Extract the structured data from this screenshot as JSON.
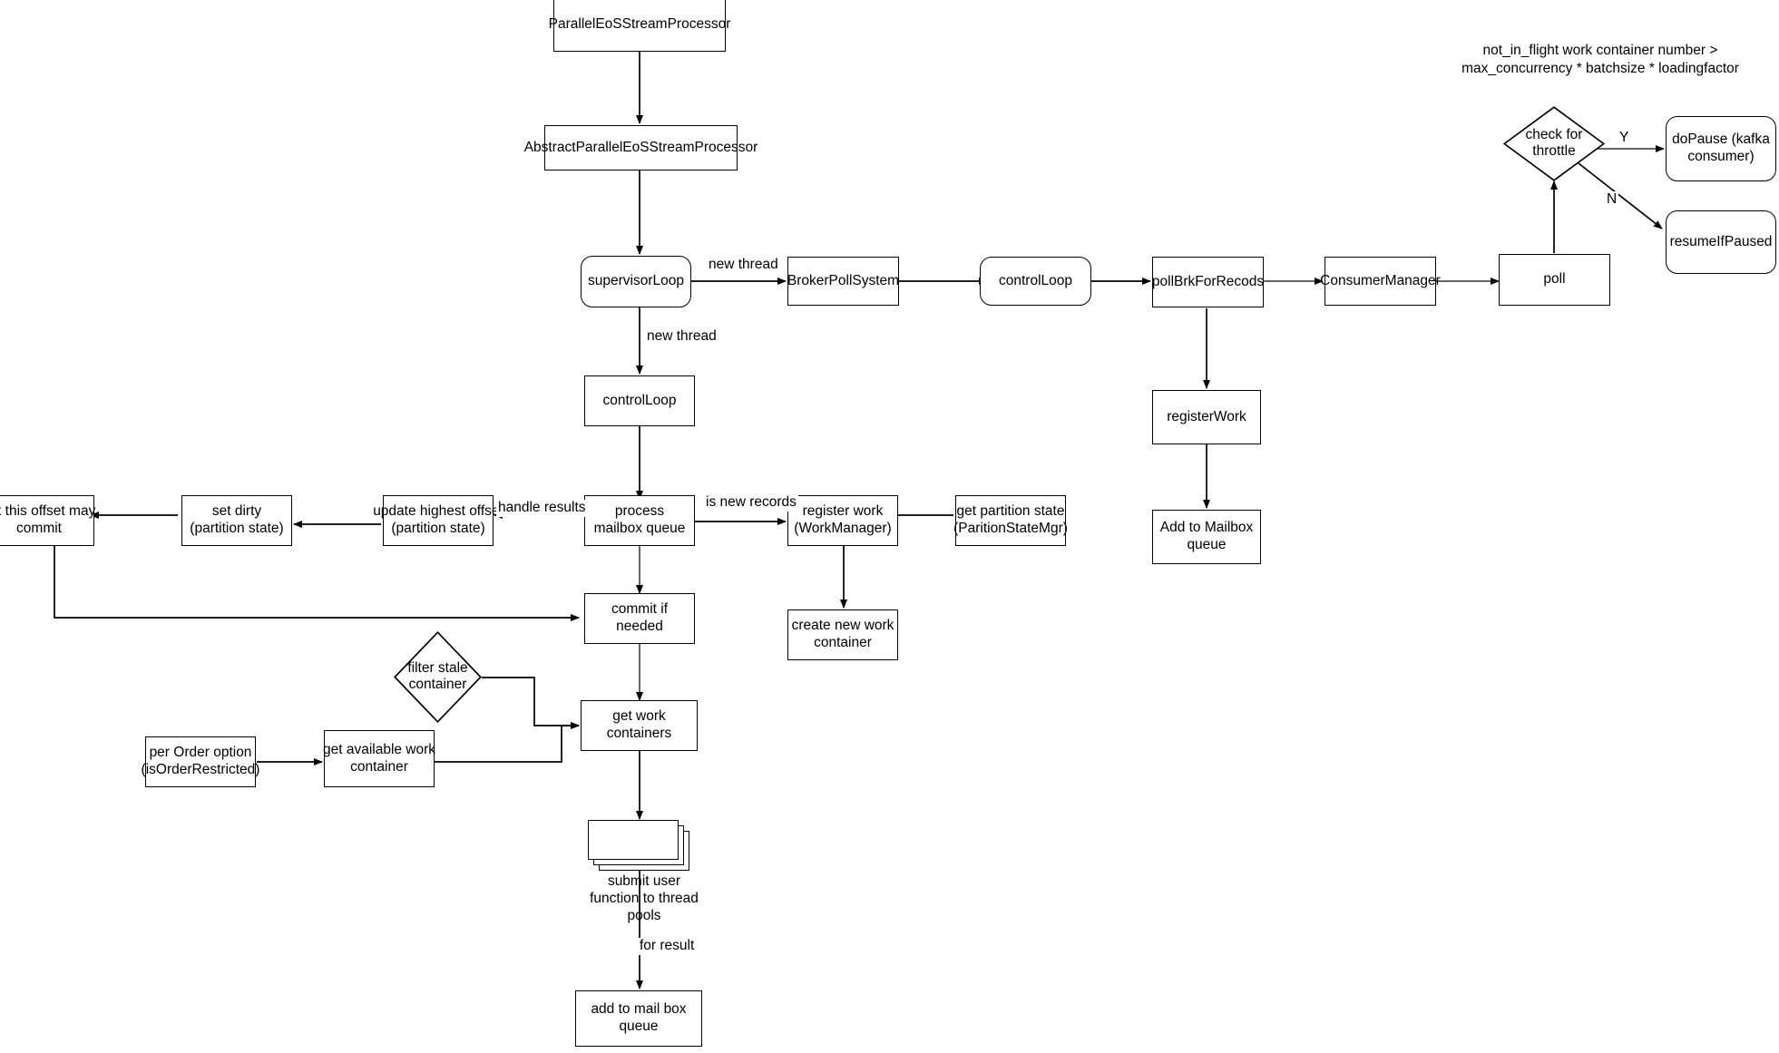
{
  "diagram": {
    "title_note": "not_in_flight work container number >\nmax_concurrency * batchsize * loadingfactor",
    "nodes": {
      "parallel_eos_stream_processor": "ParallelEoSStreamProcessor",
      "abstract_parallel_eos_stream_processor": "AbstractParallelEoSStreamProcessor",
      "supervisor_loop": "supervisorLoop",
      "broker_poll_system": "BrokerPollSystem",
      "control_loop_top": "controlLoop",
      "poll_brk_for_recods": "pollBrkForRecods",
      "consumer_manager": "ConsumerManager",
      "poll": "poll",
      "check_for_throttle": "check for\nthrottle",
      "do_pause": "doPause (kafka\nconsumer)",
      "resume_if_paused": "resumeIfPaused",
      "register_work_right": "registerWork",
      "add_to_mailbox_queue_right": "Add to Mailbox queue",
      "control_loop_left": "controlLoop",
      "process_mailbox_queue": "process\nmailbox queue",
      "update_highest_offset": "update highest offset\n(partition state)",
      "set_dirty": "set dirty\n(partition state)",
      "set_this_offset_may_commit": "set this offset may\ncommit",
      "register_work": "register work\n(WorkManager)",
      "get_partition_state": "get partition state\n(ParitionStateMgr)",
      "create_new_work_container": "create new work\ncontainer",
      "commit_if_needed": "commit if needed",
      "filter_stale_container": "filter stale\ncontainer",
      "per_order_option": "per Order option\n(isOrderRestricted)",
      "get_available_work_container": "get available work\ncontainer",
      "get_work_containers": "get work containers",
      "submit_user_function": "submit user\nfunction to thread\npools",
      "add_to_mail_box_queue": "add to mail box\nqueue"
    },
    "edge_labels": {
      "new_thread_right": "new thread",
      "new_thread_down": "new thread",
      "throttle_yes": "Y",
      "throttle_no": "N",
      "handle_results": "handle results",
      "is_new_records": "is new records",
      "for_result": "for result"
    },
    "colors": {
      "stroke": "#000000",
      "gray_stroke": "#4d4d4d",
      "fill": "#ffffff",
      "text": "#000000"
    }
  }
}
